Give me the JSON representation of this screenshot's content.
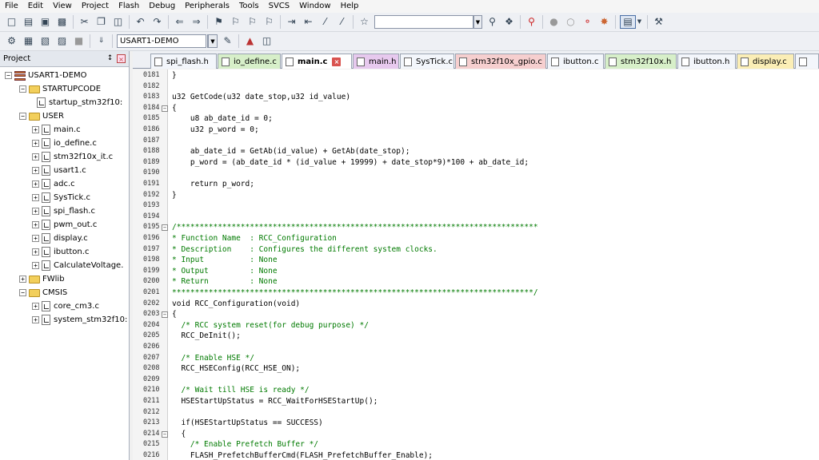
{
  "menu": [
    "File",
    "Edit",
    "View",
    "Project",
    "Flash",
    "Debug",
    "Peripherals",
    "Tools",
    "SVCS",
    "Window",
    "Help"
  ],
  "toolbar": {
    "find_value": "",
    "target_name": "USART1-DEMO"
  },
  "project_panel": {
    "title": "Project",
    "pin_glyph": "↕",
    "close_glyph": "×"
  },
  "tree": [
    {
      "label": "USART1-DEMO",
      "kind": "root",
      "level": 0,
      "expander": "−"
    },
    {
      "label": "STARTUPCODE",
      "kind": "folder",
      "level": 1,
      "expander": "−"
    },
    {
      "label": "startup_stm32f10:",
      "kind": "file",
      "level": 2,
      "expander": ""
    },
    {
      "label": "USER",
      "kind": "folder",
      "level": 1,
      "expander": "−"
    },
    {
      "label": "main.c",
      "kind": "file",
      "level": 2,
      "expander": "+"
    },
    {
      "label": "io_define.c",
      "kind": "file",
      "level": 2,
      "expander": "+"
    },
    {
      "label": "stm32f10x_it.c",
      "kind": "file",
      "level": 2,
      "expander": "+"
    },
    {
      "label": "usart1.c",
      "kind": "file",
      "level": 2,
      "expander": "+"
    },
    {
      "label": "adc.c",
      "kind": "file",
      "level": 2,
      "expander": "+"
    },
    {
      "label": "SysTick.c",
      "kind": "file",
      "level": 2,
      "expander": "+"
    },
    {
      "label": "spi_flash.c",
      "kind": "file",
      "level": 2,
      "expander": "+"
    },
    {
      "label": "pwm_out.c",
      "kind": "file",
      "level": 2,
      "expander": "+"
    },
    {
      "label": "display.c",
      "kind": "file",
      "level": 2,
      "expander": "+"
    },
    {
      "label": "ibutton.c",
      "kind": "file",
      "level": 2,
      "expander": "+"
    },
    {
      "label": "CalculateVoltage.",
      "kind": "file",
      "level": 2,
      "expander": "+"
    },
    {
      "label": "FWlib",
      "kind": "folder",
      "level": 1,
      "expander": "+"
    },
    {
      "label": "CMSIS",
      "kind": "folder",
      "level": 1,
      "expander": "−"
    },
    {
      "label": "core_cm3.c",
      "kind": "file",
      "level": 2,
      "expander": "+"
    },
    {
      "label": "system_stm32f10:",
      "kind": "file",
      "level": 2,
      "expander": "+"
    }
  ],
  "tabs": [
    {
      "label": "spi_flash.h",
      "color": "#f3f6fb",
      "active": false,
      "closable": false
    },
    {
      "label": "io_define.c",
      "color": "#d7efc9",
      "active": false,
      "closable": false
    },
    {
      "label": "main.c",
      "color": "#ffffff",
      "active": true,
      "closable": true
    },
    {
      "label": "main.h",
      "color": "#e7c9ee",
      "active": false,
      "closable": false
    },
    {
      "label": "SysTick.c",
      "color": "#f3f6fb",
      "active": false,
      "closable": false
    },
    {
      "label": "stm32f10x_gpio.c",
      "color": "#f6cfcf",
      "active": false,
      "closable": false
    },
    {
      "label": "ibutton.c",
      "color": "#f3f6fb",
      "active": false,
      "closable": false
    },
    {
      "label": "stm32f10x.h",
      "color": "#d7efc9",
      "active": false,
      "closable": false
    },
    {
      "label": "ibutton.h",
      "color": "#f3f6fb",
      "active": false,
      "closable": false
    },
    {
      "label": "display.c",
      "color": "#fbeeb6",
      "active": false,
      "closable": false
    },
    {
      "label": "",
      "color": "#f3f6fb",
      "active": false,
      "closable": false
    }
  ],
  "code_lines": [
    {
      "num": "0181",
      "text": "}",
      "fold": "",
      "type": "code"
    },
    {
      "num": "0182",
      "text": "",
      "fold": "",
      "type": "code"
    },
    {
      "num": "0183",
      "text": "u32 GetCode(u32 date_stop,u32 id_value)",
      "fold": "",
      "type": "code"
    },
    {
      "num": "0184",
      "text": "{",
      "fold": "−",
      "type": "code"
    },
    {
      "num": "0185",
      "text": "    u8 ab_date_id = 0;",
      "fold": "",
      "type": "code"
    },
    {
      "num": "0186",
      "text": "    u32 p_word = 0;",
      "fold": "",
      "type": "code"
    },
    {
      "num": "0187",
      "text": "",
      "fold": "",
      "type": "code"
    },
    {
      "num": "0188",
      "text": "    ab_date_id = GetAb(id_value) + GetAb(date_stop);",
      "fold": "",
      "type": "code"
    },
    {
      "num": "0189",
      "text": "    p_word = (ab_date_id * (id_value + 19999) + date_stop*9)*100 + ab_date_id;",
      "fold": "",
      "type": "code"
    },
    {
      "num": "0190",
      "text": "",
      "fold": "",
      "type": "code"
    },
    {
      "num": "0191",
      "text": "    return p_word;",
      "fold": "",
      "type": "code"
    },
    {
      "num": "0192",
      "text": "}",
      "fold": "",
      "type": "code"
    },
    {
      "num": "0193",
      "text": "",
      "fold": "",
      "type": "code"
    },
    {
      "num": "0194",
      "text": "",
      "fold": "",
      "type": "code"
    },
    {
      "num": "0195",
      "text": "/*******************************************************************************",
      "fold": "−",
      "type": "comment"
    },
    {
      "num": "0196",
      "text": "* Function Name  : RCC_Configuration",
      "fold": "",
      "type": "comment"
    },
    {
      "num": "0197",
      "text": "* Description    : Configures the different system clocks.",
      "fold": "",
      "type": "comment"
    },
    {
      "num": "0198",
      "text": "* Input          : None",
      "fold": "",
      "type": "comment"
    },
    {
      "num": "0199",
      "text": "* Output         : None",
      "fold": "",
      "type": "comment"
    },
    {
      "num": "0200",
      "text": "* Return         : None",
      "fold": "",
      "type": "comment"
    },
    {
      "num": "0201",
      "text": "*******************************************************************************/",
      "fold": "",
      "type": "comment"
    },
    {
      "num": "0202",
      "text": "void RCC_Configuration(void)",
      "fold": "",
      "type": "code"
    },
    {
      "num": "0203",
      "text": "{",
      "fold": "−",
      "type": "code"
    },
    {
      "num": "0204",
      "text": "  /* RCC system reset(for debug purpose) */",
      "fold": "",
      "type": "comment"
    },
    {
      "num": "0205",
      "text": "  RCC_DeInit();",
      "fold": "",
      "type": "code"
    },
    {
      "num": "0206",
      "text": "",
      "fold": "",
      "type": "code"
    },
    {
      "num": "0207",
      "text": "  /* Enable HSE */",
      "fold": "",
      "type": "comment"
    },
    {
      "num": "0208",
      "text": "  RCC_HSEConfig(RCC_HSE_ON);",
      "fold": "",
      "type": "code"
    },
    {
      "num": "0209",
      "text": "",
      "fold": "",
      "type": "code"
    },
    {
      "num": "0210",
      "text": "  /* Wait till HSE is ready */",
      "fold": "",
      "type": "comment"
    },
    {
      "num": "0211",
      "text": "  HSEStartUpStatus = RCC_WaitForHSEStartUp();",
      "fold": "",
      "type": "code"
    },
    {
      "num": "0212",
      "text": "",
      "fold": "",
      "type": "code"
    },
    {
      "num": "0213",
      "text": "  if(HSEStartUpStatus == SUCCESS)",
      "fold": "",
      "type": "code"
    },
    {
      "num": "0214",
      "text": "  {",
      "fold": "−",
      "type": "code"
    },
    {
      "num": "0215",
      "text": "    /* Enable Prefetch Buffer */",
      "fold": "",
      "type": "comment"
    },
    {
      "num": "0216",
      "text": "    FLASH_PrefetchBufferCmd(FLASH_PrefetchBuffer_Enable);",
      "fold": "",
      "type": "code"
    }
  ]
}
